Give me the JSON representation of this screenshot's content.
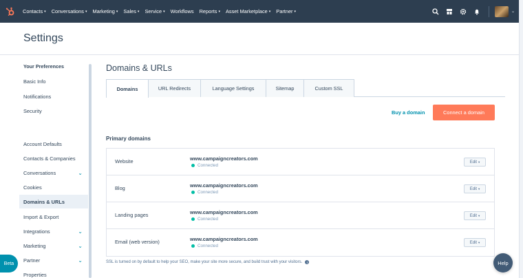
{
  "topnav": {
    "logo": "hubspot-logo",
    "items": [
      "Contacts",
      "Conversations",
      "Marketing",
      "Sales",
      "Service",
      "Workflows",
      "Reports",
      "Asset Marketplace",
      "Partner"
    ],
    "items_with_caret": [
      true,
      true,
      true,
      true,
      true,
      false,
      true,
      true,
      true
    ],
    "icons": [
      "search-icon",
      "marketplace-icon",
      "gear-icon",
      "bell-icon"
    ]
  },
  "header": {
    "title": "Settings"
  },
  "sidebar": {
    "heading": "Your Preferences",
    "items": [
      {
        "label": "Basic Info"
      },
      {
        "label": "Notifications"
      },
      {
        "label": "Security"
      },
      {
        "label": "Account Defaults"
      },
      {
        "label": "Contacts & Companies"
      },
      {
        "label": "Conversations",
        "expandable": true
      },
      {
        "label": "Cookies"
      },
      {
        "label": "Domains & URLs",
        "active": true
      },
      {
        "label": "Import & Export"
      },
      {
        "label": "Integrations",
        "expandable": true
      },
      {
        "label": "Marketing",
        "expandable": true
      },
      {
        "label": "Partner",
        "expandable": true
      },
      {
        "label": "Properties"
      }
    ]
  },
  "main": {
    "title": "Domains & URLs",
    "tabs": [
      {
        "label": "Domains",
        "active": true
      },
      {
        "label": "URL Redirects"
      },
      {
        "label": "Language Settings"
      },
      {
        "label": "Sitemap"
      },
      {
        "label": "Custom SSL"
      }
    ],
    "buy_link": "Buy a domain",
    "connect_button": "Connect a domain",
    "section_title": "Primary domains",
    "rows": [
      {
        "label": "Website",
        "url": "www.campaigncreators.com",
        "status": "Connected",
        "edit": "Edit"
      },
      {
        "label": "Blog",
        "url": "www.campaigncreators.com",
        "status": "Connected",
        "edit": "Edit"
      },
      {
        "label": "Landing pages",
        "url": "www.campaigncreators.com",
        "status": "Connected",
        "edit": "Edit"
      },
      {
        "label": "Email (web version)",
        "url": "www.campaigncreators.com",
        "status": "Connected",
        "edit": "Edit"
      }
    ],
    "ssl_note": "SSL is turned on by default to help your SEO, make your site more secure, and build trust with your visitors."
  },
  "floating": {
    "beta": "Beta",
    "help": "Help"
  },
  "colors": {
    "nav_bg": "#2d3e50",
    "accent_orange": "#ff7a59",
    "link_teal": "#0091ae",
    "status_green": "#00bda5"
  }
}
